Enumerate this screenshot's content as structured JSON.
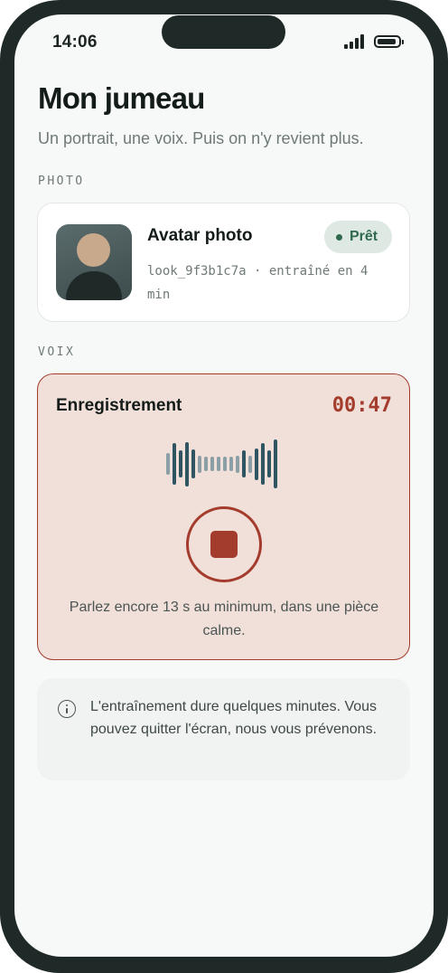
{
  "status_bar": {
    "time": "14:06",
    "signal_icon": "cellular-signal-icon",
    "battery_icon": "battery-icon"
  },
  "header": {
    "title": "Mon jumeau",
    "subtitle": "Un portrait, une voix. Puis on n'y revient plus."
  },
  "photo_section": {
    "label": "PHOTO",
    "card": {
      "title": "Avatar photo",
      "badge": "Prêt",
      "meta": "look_9f3b1c7a · entraîné en 4 min",
      "avatar_icon": "person-avatar-icon"
    }
  },
  "voice_section": {
    "label": "VOIX",
    "card": {
      "title": "Enregistrement",
      "timer": "00:47",
      "stop_icon": "stop-icon",
      "hint": "Parlez encore 13 s au minimum, dans une pièce calme.",
      "waveform_levels": [
        0.45,
        0.85,
        0.55,
        0.9,
        0.6,
        0.35,
        0.3,
        0.3,
        0.3,
        0.3,
        0.3,
        0.35,
        0.55,
        0.35,
        0.65,
        0.85,
        0.55,
        1.0
      ]
    }
  },
  "info": {
    "icon": "info-icon",
    "text": "L'entraînement dure quelques minutes. Vous pouvez quitter l'écran, nous vous prévenons."
  },
  "colors": {
    "accent_red": "#a33c2c",
    "recording_bg": "#f1dfd9",
    "ready_green": "#2f6a4f",
    "wave_dark": "#2f5563",
    "wave_light": "#8a9fa6"
  }
}
